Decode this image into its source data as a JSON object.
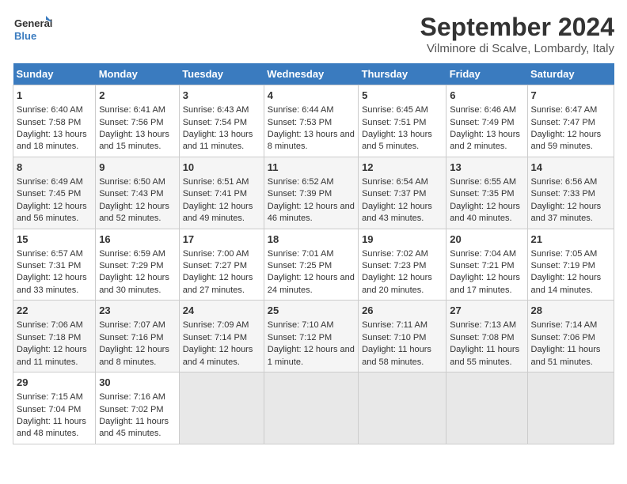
{
  "logo": {
    "line1": "General",
    "line2": "Blue"
  },
  "title": "September 2024",
  "subtitle": "Vilminore di Scalve, Lombardy, Italy",
  "headers": [
    "Sunday",
    "Monday",
    "Tuesday",
    "Wednesday",
    "Thursday",
    "Friday",
    "Saturday"
  ],
  "weeks": [
    [
      {
        "day": "1",
        "info": "Sunrise: 6:40 AM\nSunset: 7:58 PM\nDaylight: 13 hours and 18 minutes."
      },
      {
        "day": "2",
        "info": "Sunrise: 6:41 AM\nSunset: 7:56 PM\nDaylight: 13 hours and 15 minutes."
      },
      {
        "day": "3",
        "info": "Sunrise: 6:43 AM\nSunset: 7:54 PM\nDaylight: 13 hours and 11 minutes."
      },
      {
        "day": "4",
        "info": "Sunrise: 6:44 AM\nSunset: 7:53 PM\nDaylight: 13 hours and 8 minutes."
      },
      {
        "day": "5",
        "info": "Sunrise: 6:45 AM\nSunset: 7:51 PM\nDaylight: 13 hours and 5 minutes."
      },
      {
        "day": "6",
        "info": "Sunrise: 6:46 AM\nSunset: 7:49 PM\nDaylight: 13 hours and 2 minutes."
      },
      {
        "day": "7",
        "info": "Sunrise: 6:47 AM\nSunset: 7:47 PM\nDaylight: 12 hours and 59 minutes."
      }
    ],
    [
      {
        "day": "8",
        "info": "Sunrise: 6:49 AM\nSunset: 7:45 PM\nDaylight: 12 hours and 56 minutes."
      },
      {
        "day": "9",
        "info": "Sunrise: 6:50 AM\nSunset: 7:43 PM\nDaylight: 12 hours and 52 minutes."
      },
      {
        "day": "10",
        "info": "Sunrise: 6:51 AM\nSunset: 7:41 PM\nDaylight: 12 hours and 49 minutes."
      },
      {
        "day": "11",
        "info": "Sunrise: 6:52 AM\nSunset: 7:39 PM\nDaylight: 12 hours and 46 minutes."
      },
      {
        "day": "12",
        "info": "Sunrise: 6:54 AM\nSunset: 7:37 PM\nDaylight: 12 hours and 43 minutes."
      },
      {
        "day": "13",
        "info": "Sunrise: 6:55 AM\nSunset: 7:35 PM\nDaylight: 12 hours and 40 minutes."
      },
      {
        "day": "14",
        "info": "Sunrise: 6:56 AM\nSunset: 7:33 PM\nDaylight: 12 hours and 37 minutes."
      }
    ],
    [
      {
        "day": "15",
        "info": "Sunrise: 6:57 AM\nSunset: 7:31 PM\nDaylight: 12 hours and 33 minutes."
      },
      {
        "day": "16",
        "info": "Sunrise: 6:59 AM\nSunset: 7:29 PM\nDaylight: 12 hours and 30 minutes."
      },
      {
        "day": "17",
        "info": "Sunrise: 7:00 AM\nSunset: 7:27 PM\nDaylight: 12 hours and 27 minutes."
      },
      {
        "day": "18",
        "info": "Sunrise: 7:01 AM\nSunset: 7:25 PM\nDaylight: 12 hours and 24 minutes."
      },
      {
        "day": "19",
        "info": "Sunrise: 7:02 AM\nSunset: 7:23 PM\nDaylight: 12 hours and 20 minutes."
      },
      {
        "day": "20",
        "info": "Sunrise: 7:04 AM\nSunset: 7:21 PM\nDaylight: 12 hours and 17 minutes."
      },
      {
        "day": "21",
        "info": "Sunrise: 7:05 AM\nSunset: 7:19 PM\nDaylight: 12 hours and 14 minutes."
      }
    ],
    [
      {
        "day": "22",
        "info": "Sunrise: 7:06 AM\nSunset: 7:18 PM\nDaylight: 12 hours and 11 minutes."
      },
      {
        "day": "23",
        "info": "Sunrise: 7:07 AM\nSunset: 7:16 PM\nDaylight: 12 hours and 8 minutes."
      },
      {
        "day": "24",
        "info": "Sunrise: 7:09 AM\nSunset: 7:14 PM\nDaylight: 12 hours and 4 minutes."
      },
      {
        "day": "25",
        "info": "Sunrise: 7:10 AM\nSunset: 7:12 PM\nDaylight: 12 hours and 1 minute."
      },
      {
        "day": "26",
        "info": "Sunrise: 7:11 AM\nSunset: 7:10 PM\nDaylight: 11 hours and 58 minutes."
      },
      {
        "day": "27",
        "info": "Sunrise: 7:13 AM\nSunset: 7:08 PM\nDaylight: 11 hours and 55 minutes."
      },
      {
        "day": "28",
        "info": "Sunrise: 7:14 AM\nSunset: 7:06 PM\nDaylight: 11 hours and 51 minutes."
      }
    ],
    [
      {
        "day": "29",
        "info": "Sunrise: 7:15 AM\nSunset: 7:04 PM\nDaylight: 11 hours and 48 minutes."
      },
      {
        "day": "30",
        "info": "Sunrise: 7:16 AM\nSunset: 7:02 PM\nDaylight: 11 hours and 45 minutes."
      },
      {
        "day": "",
        "info": ""
      },
      {
        "day": "",
        "info": ""
      },
      {
        "day": "",
        "info": ""
      },
      {
        "day": "",
        "info": ""
      },
      {
        "day": "",
        "info": ""
      }
    ]
  ]
}
